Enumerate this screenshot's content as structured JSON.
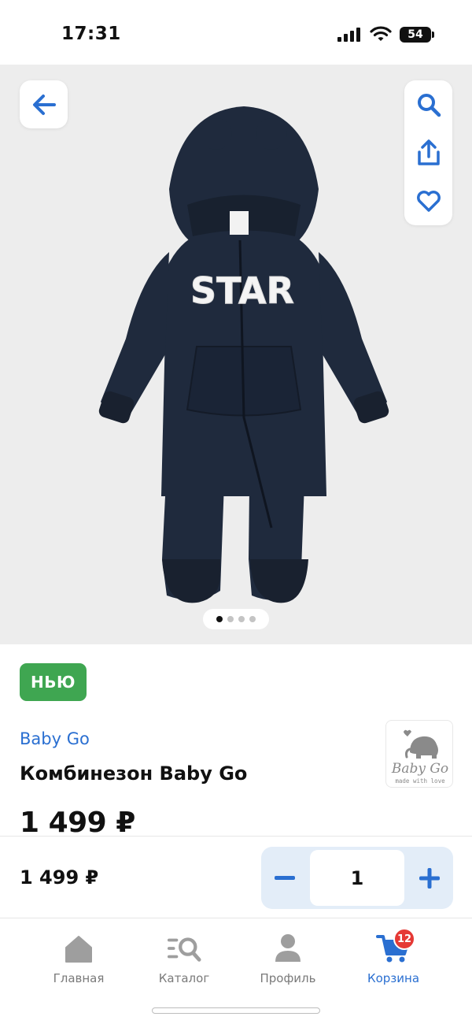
{
  "status_bar": {
    "time": "17:31",
    "battery": "54"
  },
  "gallery": {
    "back_icon": "arrow-left-icon",
    "actions": [
      "search-icon",
      "share-icon",
      "heart-icon"
    ],
    "image_print": "STAR",
    "pages": 4,
    "active_page": 1
  },
  "product": {
    "badge": "НЬЮ",
    "brand": "Baby Go",
    "title": "Комбинезон Baby Go",
    "price": "1 499 ₽",
    "brand_logo": {
      "name": "Baby Go",
      "tagline": "made with love"
    }
  },
  "purchase_bar": {
    "price": "1 499 ₽",
    "quantity": "1",
    "minus_icon": "minus-icon",
    "plus_icon": "plus-icon"
  },
  "tabs": [
    {
      "label": "Главная",
      "icon": "home-icon"
    },
    {
      "label": "Каталог",
      "icon": "catalog-search-icon"
    },
    {
      "label": "Профиль",
      "icon": "user-icon"
    },
    {
      "label": "Корзина",
      "icon": "cart-icon",
      "badge": "12",
      "active": true
    }
  ],
  "colors": {
    "accent": "#2a6fd1",
    "badge_green": "#3fa651",
    "cart_badge": "#e53935",
    "stepper_bg": "#e3edf8",
    "gallery_bg": "#ededed"
  }
}
